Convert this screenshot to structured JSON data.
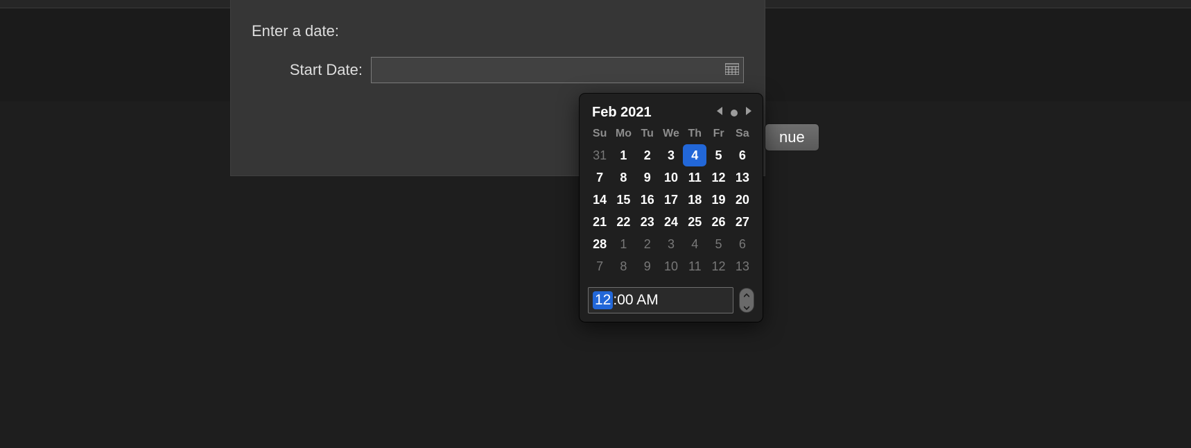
{
  "dialog": {
    "prompt": "Enter a date:",
    "field_label": "Start Date:",
    "input_value": "",
    "continue_label": "nue"
  },
  "datepicker": {
    "month_title": "Feb 2021",
    "dow": [
      "Su",
      "Mo",
      "Tu",
      "We",
      "Th",
      "Fr",
      "Sa"
    ],
    "weeks": [
      [
        {
          "n": "31",
          "other": true
        },
        {
          "n": "1"
        },
        {
          "n": "2"
        },
        {
          "n": "3"
        },
        {
          "n": "4",
          "selected": true
        },
        {
          "n": "5"
        },
        {
          "n": "6"
        }
      ],
      [
        {
          "n": "7"
        },
        {
          "n": "8"
        },
        {
          "n": "9"
        },
        {
          "n": "10"
        },
        {
          "n": "11"
        },
        {
          "n": "12"
        },
        {
          "n": "13"
        }
      ],
      [
        {
          "n": "14"
        },
        {
          "n": "15"
        },
        {
          "n": "16"
        },
        {
          "n": "17"
        },
        {
          "n": "18"
        },
        {
          "n": "19"
        },
        {
          "n": "20"
        }
      ],
      [
        {
          "n": "21"
        },
        {
          "n": "22"
        },
        {
          "n": "23"
        },
        {
          "n": "24"
        },
        {
          "n": "25"
        },
        {
          "n": "26"
        },
        {
          "n": "27"
        }
      ],
      [
        {
          "n": "28"
        },
        {
          "n": "1",
          "other": true
        },
        {
          "n": "2",
          "other": true
        },
        {
          "n": "3",
          "other": true
        },
        {
          "n": "4",
          "other": true
        },
        {
          "n": "5",
          "other": true
        },
        {
          "n": "6",
          "other": true
        }
      ],
      [
        {
          "n": "7",
          "other": true
        },
        {
          "n": "8",
          "other": true
        },
        {
          "n": "9",
          "other": true
        },
        {
          "n": "10",
          "other": true
        },
        {
          "n": "11",
          "other": true
        },
        {
          "n": "12",
          "other": true
        },
        {
          "n": "13",
          "other": true
        }
      ]
    ],
    "time": {
      "hour": "12",
      "rest": ":00 AM"
    }
  }
}
